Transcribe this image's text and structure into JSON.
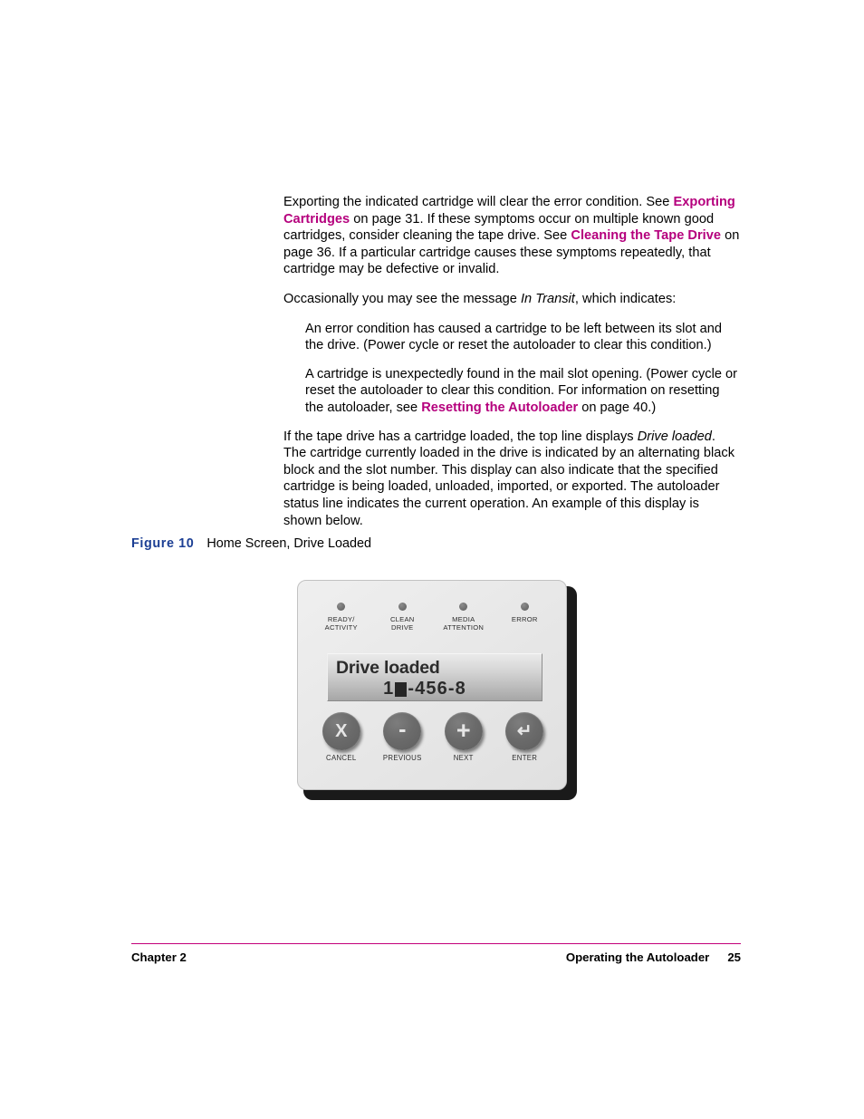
{
  "page": {
    "colors": {
      "xref_magenta": "#b5007d",
      "figure_blue": "#1c3f94",
      "footer_rule": "#c2007a"
    }
  },
  "paragraphs": {
    "p1": {
      "seg1": "Exporting the indicated cartridge will clear the error condition. See ",
      "link1": "Exporting Cartridges",
      "seg2": " on page 31. If these symptoms occur on multiple known good cartridges, consider cleaning the tape drive. See ",
      "link2": "Cleaning the Tape Drive",
      "seg3": " on page 36. If a particular cartridge causes these symptoms repeatedly, that cartridge may be defective or invalid."
    },
    "p2": {
      "seg1": "Occasionally you may see the message ",
      "italic1": "In Transit",
      "seg2": ", which indicates:"
    },
    "p3": "An error condition has caused a cartridge to be left between its slot and the drive. (Power cycle or reset the autoloader to clear this condition.)",
    "p4": {
      "seg1": "A cartridge is unexpectedly found in the mail slot opening. (Power cycle or reset the autoloader to clear this condition. For information on resetting the autoloader, see ",
      "link1": "Resetting the Autoloader",
      "seg2": " on page 40.)"
    },
    "p5": {
      "seg1": "If the tape drive has a cartridge loaded, the top line displays ",
      "italic1": "Drive loaded",
      "seg2": ". The cartridge currently loaded in the drive is indicated by an alternating black block and the slot number. This display can also indicate that the specified cartridge is being loaded, unloaded, imported, or exported. The autoloader status line indicates the current operation. An example of this display is shown below."
    }
  },
  "figure": {
    "label": "Figure 10",
    "title": "Home Screen, Drive Loaded",
    "panel": {
      "leds": [
        {
          "name": "ready-activity",
          "label": "READY/\nACTIVITY"
        },
        {
          "name": "clean-drive",
          "label": "CLEAN\nDRIVE"
        },
        {
          "name": "media-attention",
          "label": "MEDIA\nATTENTION"
        },
        {
          "name": "error",
          "label": "ERROR"
        }
      ],
      "lcd": {
        "line1": "Drive loaded",
        "line2_prefix": "1",
        "line2_suffix": "-456-8"
      },
      "buttons": [
        {
          "name": "cancel",
          "glyph": "X",
          "label": "CANCEL"
        },
        {
          "name": "previous",
          "glyph": "-",
          "label": "PREVIOUS"
        },
        {
          "name": "next",
          "glyph": "+",
          "label": "NEXT"
        },
        {
          "name": "enter",
          "glyph": "↵",
          "label": "ENTER"
        }
      ]
    }
  },
  "footer": {
    "left": "Chapter 2",
    "right": "Operating the Autoloader",
    "page_number": "25"
  }
}
